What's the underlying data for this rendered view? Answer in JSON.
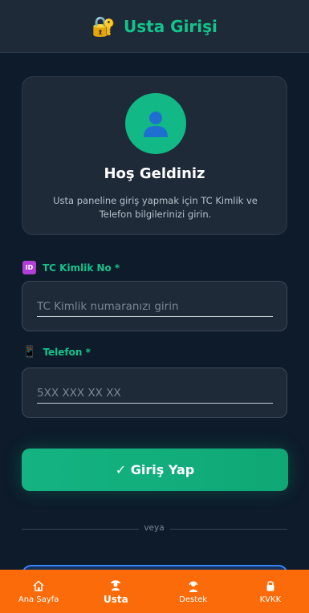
{
  "header": {
    "icon": "lock-with-key-icon",
    "title": "Usta Girişi"
  },
  "welcome": {
    "avatar_icon": "user-silhouette-icon",
    "title": "Hoş Geldiniz",
    "subtitle": "Usta paneline giriş yapmak için TC Kimlik ve Telefon bilgilerinizi girin."
  },
  "form": {
    "tc": {
      "badge": "ID",
      "label": "TC Kimlik No *",
      "placeholder": "TC Kimlik numaranızı girin",
      "value": ""
    },
    "phone": {
      "icon": "mobile-phone-icon",
      "label": "Telefon *",
      "placeholder": "5XX XXX XX XX",
      "value": ""
    },
    "submit_label": "✓ Giriş Yap",
    "divider_text": "veya"
  },
  "bottom_nav": {
    "items": [
      {
        "label": "Ana Sayfa",
        "icon": "home-icon",
        "active": false
      },
      {
        "label": "Usta",
        "icon": "worker-icon",
        "active": true
      },
      {
        "label": "Destek",
        "icon": "support-agent-icon",
        "active": false
      },
      {
        "label": "KVKK",
        "icon": "lock-icon",
        "active": false
      }
    ]
  },
  "colors": {
    "background": "#0d1b2a",
    "card": "#1e2a38",
    "accent_green": "#12c48b",
    "nav_orange": "#fb6b0a",
    "secondary_button_border": "#3b82f6"
  }
}
